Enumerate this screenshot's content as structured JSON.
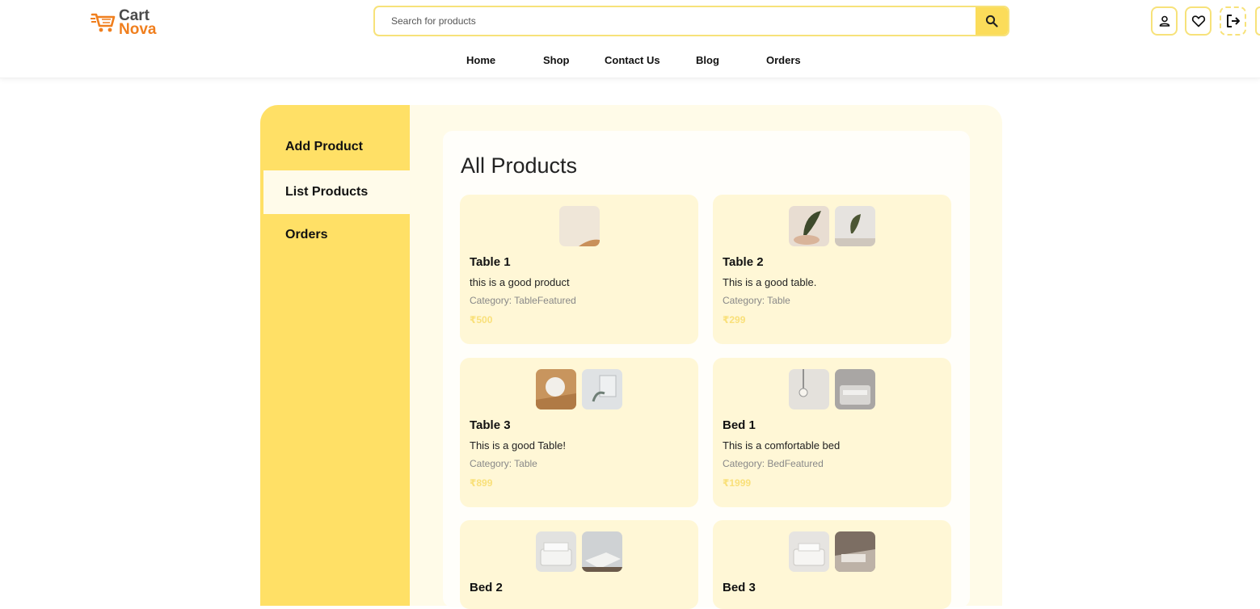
{
  "brand": {
    "line1": "Cart",
    "line2": "Nova",
    "accent": "#f07f1e"
  },
  "search": {
    "placeholder": "Search for products",
    "value": ""
  },
  "nav": [
    "Home",
    "Shop",
    "Contact Us",
    "Blog",
    "Orders"
  ],
  "header_icons": [
    "user-icon",
    "heart-icon",
    "logout-icon"
  ],
  "sidebar": {
    "items": [
      {
        "label": "Add Product",
        "active": false
      },
      {
        "label": "List Products",
        "active": true
      },
      {
        "label": "Orders",
        "active": false
      }
    ]
  },
  "main": {
    "title": "All Products",
    "products": [
      {
        "name": "Table 1",
        "desc": "this is a good product",
        "category": "Category: TableFeatured",
        "price": "₹500"
      },
      {
        "name": "Table 2",
        "desc": "This is a good table.",
        "category": "Category: Table",
        "price": "₹299"
      },
      {
        "name": "Table 3",
        "desc": "This is a good Table!",
        "category": "Category: Table",
        "price": "₹899"
      },
      {
        "name": "Bed 1",
        "desc": "This is a comfortable bed",
        "category": "Category: BedFeatured",
        "price": "₹1999"
      },
      {
        "name": "Bed 2",
        "desc": "",
        "category": "",
        "price": ""
      },
      {
        "name": "Bed 3",
        "desc": "",
        "category": "",
        "price": ""
      }
    ]
  },
  "colors": {
    "primary": "#ffe066",
    "panel": "#fff7d6",
    "border": "#f7e27a"
  }
}
